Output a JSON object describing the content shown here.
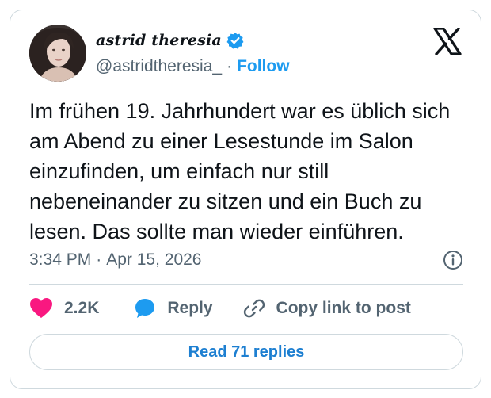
{
  "author": {
    "display_name": "astrid theresia",
    "handle": "@astridtheresia_",
    "separator": "·",
    "follow_label": "Follow"
  },
  "tweet": {
    "text": "Im frühen 19. Jahrhundert war es üblich sich am Abend zu einer Lesestunde im Salon einzufinden, um einfach nur still nebeneinander zu sitzen und ein Buch zu lesen. Das sollte man wieder einführen.",
    "time": "3:34 PM",
    "separator": "·",
    "date": "Apr 15, 2026"
  },
  "actions": {
    "likes_count": "2.2K",
    "reply_label": "Reply",
    "copy_link_label": "Copy link to post"
  },
  "read_replies_label": "Read 71 replies",
  "icons": {
    "verified": "verified-badge-icon",
    "brand": "x-logo-icon",
    "info": "info-icon",
    "like": "heart-icon",
    "reply": "speech-bubble-icon",
    "copy": "link-icon"
  },
  "colors": {
    "accent": "#1d9bf0",
    "like": "#f91880",
    "text": "#0f1419",
    "muted": "#536471",
    "border": "#cfd9de"
  }
}
